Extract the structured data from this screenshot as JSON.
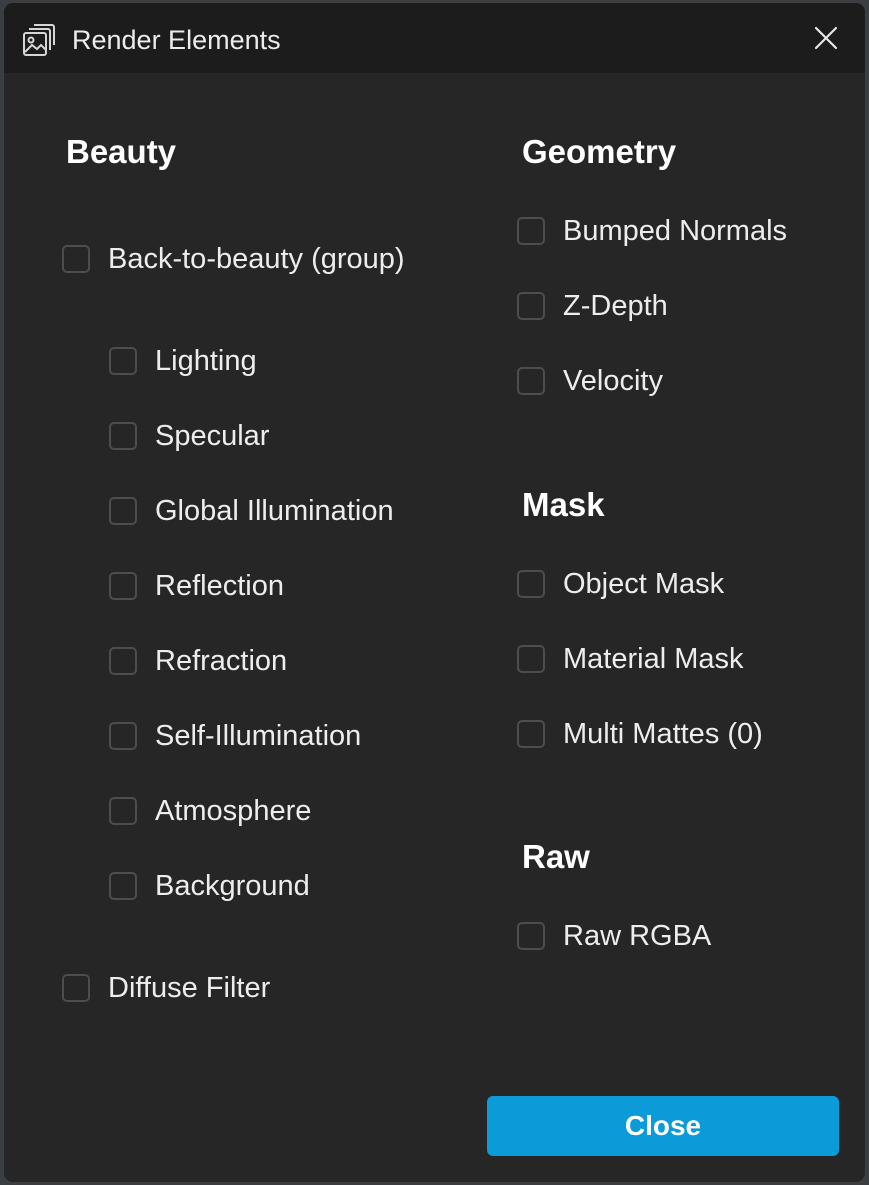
{
  "window": {
    "title": "Render Elements",
    "title_icon": "stacked-images-icon",
    "close_icon": "close-icon"
  },
  "beauty": {
    "heading": "Beauty",
    "group": {
      "label": "Back-to-beauty (group)",
      "checked": false
    },
    "items": [
      {
        "label": "Lighting",
        "checked": false
      },
      {
        "label": "Specular",
        "checked": false
      },
      {
        "label": "Global Illumination",
        "checked": false
      },
      {
        "label": "Reflection",
        "checked": false
      },
      {
        "label": "Refraction",
        "checked": false
      },
      {
        "label": "Self-Illumination",
        "checked": false
      },
      {
        "label": "Atmosphere",
        "checked": false
      },
      {
        "label": "Background",
        "checked": false
      }
    ],
    "diffuse_filter": {
      "label": "Diffuse Filter",
      "checked": false
    }
  },
  "geometry": {
    "heading": "Geometry",
    "items": [
      {
        "label": "Bumped Normals",
        "checked": false
      },
      {
        "label": "Z-Depth",
        "checked": false
      },
      {
        "label": "Velocity",
        "checked": false
      }
    ]
  },
  "mask": {
    "heading": "Mask",
    "items": [
      {
        "label": "Object Mask",
        "checked": false
      },
      {
        "label": "Material Mask",
        "checked": false
      },
      {
        "label": "Multi Mattes (0)",
        "checked": false
      }
    ]
  },
  "raw": {
    "heading": "Raw",
    "items": [
      {
        "label": "Raw RGBA",
        "checked": false
      }
    ]
  },
  "footer": {
    "close_label": "Close"
  },
  "colors": {
    "dialog_bg": "#262626",
    "titlebar_bg": "#1c1c1c",
    "accent": "#0a9bd8",
    "checkbox_border": "#4d4d4d"
  }
}
